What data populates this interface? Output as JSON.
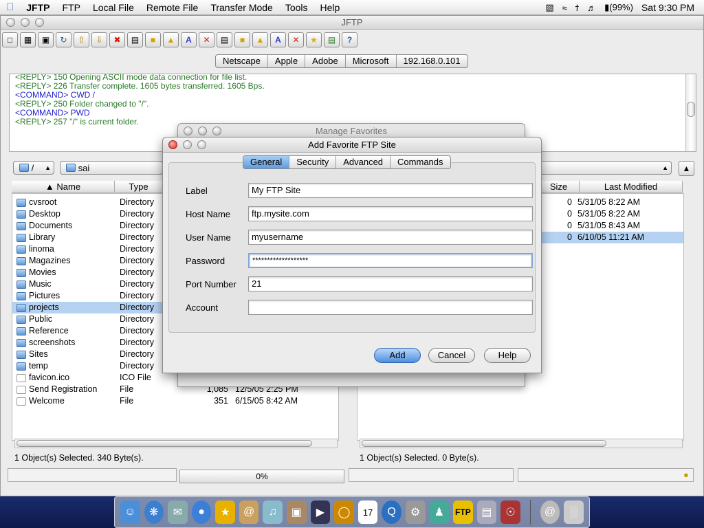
{
  "menubar": {
    "apple": "",
    "items": [
      "JFTP",
      "FTP",
      "Local File",
      "Remote File",
      "Transfer Mode",
      "Tools",
      "Help"
    ],
    "battery": "(99%)",
    "clock": "Sat 9:30 PM"
  },
  "window": {
    "title": "JFTP"
  },
  "toolbar": {
    "icons": [
      "new-window-icon",
      "connect-icon",
      "disconnect-icon",
      "refresh-icon",
      "upload-icon",
      "download-icon",
      "stop-icon",
      "new-file-icon",
      "new-folder-icon",
      "open-icon",
      "rename-icon",
      "delete-icon",
      "new-file-icon",
      "new-folder-icon",
      "open-icon",
      "rename-icon",
      "delete-icon",
      "favorites-icon",
      "log-icon",
      "help-icon"
    ]
  },
  "favorites_bar": {
    "items": [
      "Netscape",
      "Apple",
      "Adobe",
      "Microsoft",
      "192.168.0.101"
    ]
  },
  "log": {
    "lines": [
      {
        "kind": "reply",
        "text": "<REPLY> 150 Opening ASCII mode data connection for file list."
      },
      {
        "kind": "reply",
        "text": "<REPLY> 226 Transfer complete. 1605 bytes transferred. 1605 Bps."
      },
      {
        "kind": "command",
        "text": "<COMMAND> CWD /"
      },
      {
        "kind": "reply",
        "text": "<REPLY> 250 Folder changed to \"/\"."
      },
      {
        "kind": "command",
        "text": "<COMMAND> PWD"
      },
      {
        "kind": "reply",
        "text": "<REPLY> 257 \"/\" is current folder."
      }
    ]
  },
  "local": {
    "root": "/",
    "folder": "sai",
    "columns": {
      "name": "Name",
      "type": "Type"
    },
    "files": [
      {
        "name": "cvsroot",
        "type": "Directory",
        "size": "",
        "date": "",
        "icon": "folder-icon"
      },
      {
        "name": "Desktop",
        "type": "Directory",
        "size": "",
        "date": "",
        "icon": "folder-icon"
      },
      {
        "name": "Documents",
        "type": "Directory",
        "size": "",
        "date": "",
        "icon": "folder-icon"
      },
      {
        "name": "Library",
        "type": "Directory",
        "size": "",
        "date": "",
        "icon": "folder-icon"
      },
      {
        "name": "linoma",
        "type": "Directory",
        "size": "",
        "date": "",
        "icon": "folder-icon"
      },
      {
        "name": "Magazines",
        "type": "Directory",
        "size": "",
        "date": "",
        "icon": "folder-icon"
      },
      {
        "name": "Movies",
        "type": "Directory",
        "size": "",
        "date": "",
        "icon": "folder-icon"
      },
      {
        "name": "Music",
        "type": "Directory",
        "size": "",
        "date": "",
        "icon": "folder-icon"
      },
      {
        "name": "Pictures",
        "type": "Directory",
        "size": "",
        "date": "",
        "icon": "folder-icon"
      },
      {
        "name": "projects",
        "type": "Directory",
        "size": "",
        "date": "",
        "icon": "folder-icon",
        "selected": true
      },
      {
        "name": "Public",
        "type": "Directory",
        "size": "",
        "date": "",
        "icon": "folder-icon"
      },
      {
        "name": "Reference",
        "type": "Directory",
        "size": "",
        "date": "",
        "icon": "folder-icon"
      },
      {
        "name": "screenshots",
        "type": "Directory",
        "size": "",
        "date": "",
        "icon": "folder-icon"
      },
      {
        "name": "Sites",
        "type": "Directory",
        "size": "",
        "date": "",
        "icon": "folder-icon"
      },
      {
        "name": "temp",
        "type": "Directory",
        "size": "",
        "date": "",
        "icon": "folder-icon"
      },
      {
        "name": "favicon.ico",
        "type": "ICO File",
        "size": "",
        "date": "",
        "icon": "file-icon"
      },
      {
        "name": "Send Registration",
        "type": "File",
        "size": "1,085",
        "date": "12/5/05 2:25 PM",
        "icon": "file-icon"
      },
      {
        "name": "Welcome",
        "type": "File",
        "size": "351",
        "date": "6/15/05 8:42 AM",
        "icon": "file-icon"
      }
    ],
    "status": "1 Object(s) Selected. 340 Byte(s)."
  },
  "remote": {
    "columns": {
      "size": "Size",
      "modified": "Last Modified"
    },
    "files": [
      {
        "size": "0",
        "date": "5/31/05 8:22 AM"
      },
      {
        "size": "0",
        "date": "5/31/05 8:22 AM"
      },
      {
        "size": "0",
        "date": "5/31/05 8:43 AM"
      },
      {
        "size": "0",
        "date": "6/10/05 11:21 AM",
        "selected": true
      }
    ],
    "status": "1 Object(s) Selected. 0 Byte(s)."
  },
  "transfer": {
    "progress_label": "0%",
    "progress": 0
  },
  "manage_dialog": {
    "title": "Manage Favorites"
  },
  "add_dialog": {
    "title": "Add Favorite FTP Site",
    "tabs": [
      "General",
      "Security",
      "Advanced",
      "Commands"
    ],
    "active_tab": "General",
    "fields": {
      "label": {
        "label": "Label",
        "value": "My FTP Site"
      },
      "host": {
        "label": "Host Name",
        "value": "ftp.mysite.com"
      },
      "user": {
        "label": "User Name",
        "value": "myusername"
      },
      "password": {
        "label": "Password",
        "value": "*******************"
      },
      "port": {
        "label": "Port Number",
        "value": "21"
      },
      "account": {
        "label": "Account",
        "value": ""
      }
    },
    "buttons": {
      "add": "Add",
      "cancel": "Cancel",
      "help": "Help"
    }
  },
  "dock": {
    "icons": [
      "finder-icon",
      "safari-icon",
      "mail-icon",
      "ichat-icon",
      "aim-icon",
      "address-book-icon",
      "itunes-icon",
      "iphoto-icon",
      "imovie-icon",
      "idvd-icon",
      "ical-icon",
      "quicktime-icon",
      "system-preferences-icon",
      "users-icon",
      "jftp-icon",
      "ftp-icon",
      "network-icon",
      "separator",
      "downloads-icon",
      "trash-icon"
    ],
    "jftp_label": "FTP"
  },
  "colors": {
    "selection": "#b5d2f2",
    "reply": "#2a7a2a",
    "command": "#2222cc",
    "default_button": "#4f8fe0"
  }
}
